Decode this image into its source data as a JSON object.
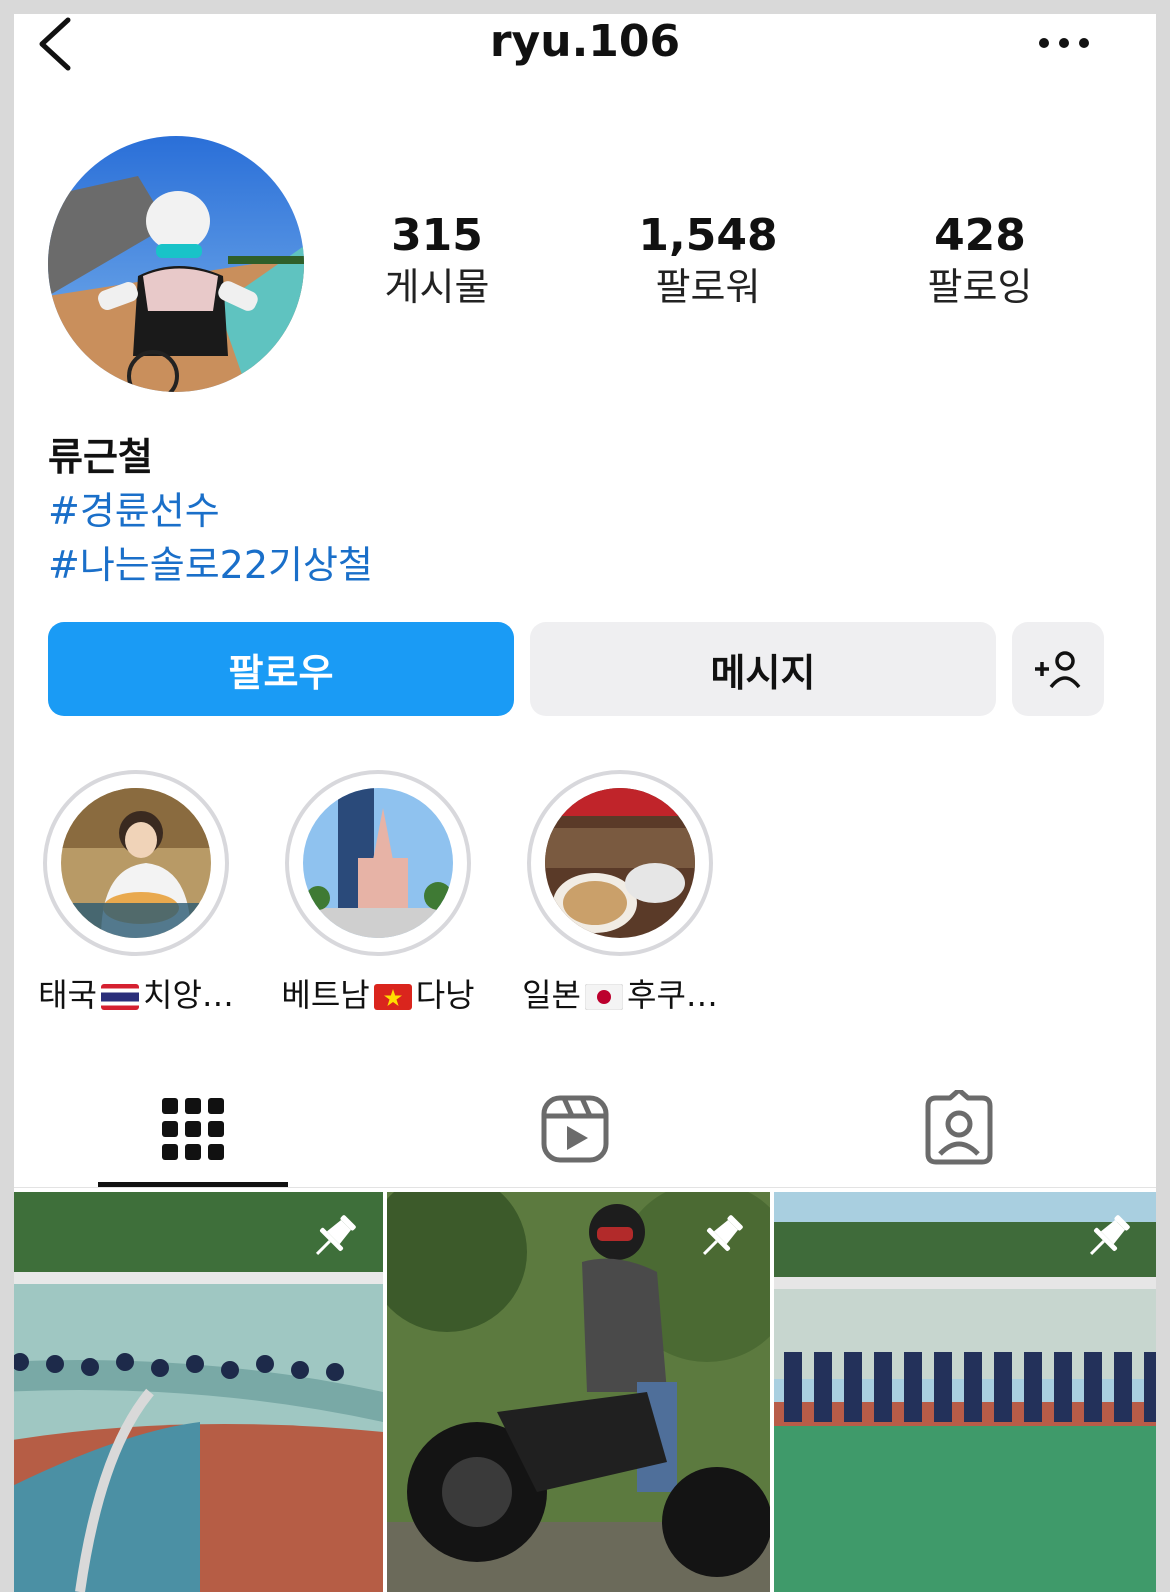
{
  "header": {
    "username": "ryu.106",
    "back_icon": "chevron-left-icon",
    "more_icon": "ellipsis-icon"
  },
  "profile": {
    "stats": [
      {
        "count": "315",
        "label": "게시물"
      },
      {
        "count": "1,548",
        "label": "팔로워"
      },
      {
        "count": "428",
        "label": "팔로잉"
      }
    ],
    "name": "류근철",
    "bio_tags": [
      "#경륜선수",
      "#나는솔로22기상철"
    ]
  },
  "actions": {
    "follow_label": "팔로우",
    "message_label": "메시지",
    "add_person_icon": "add-person-icon"
  },
  "highlights": [
    {
      "before": "태국",
      "flag": "thailand-flag",
      "after": "치앙…"
    },
    {
      "before": "베트남",
      "flag": "vietnam-flag",
      "after": "다낭"
    },
    {
      "before": "일본",
      "flag": "japan-flag",
      "after": "후쿠…"
    }
  ],
  "tabs": [
    "grid-icon",
    "reels-icon",
    "tagged-icon"
  ],
  "colors": {
    "follow_button": "#1a9bf5",
    "hashtag": "#1a6fc9",
    "secondary_button": "#efeff1"
  }
}
